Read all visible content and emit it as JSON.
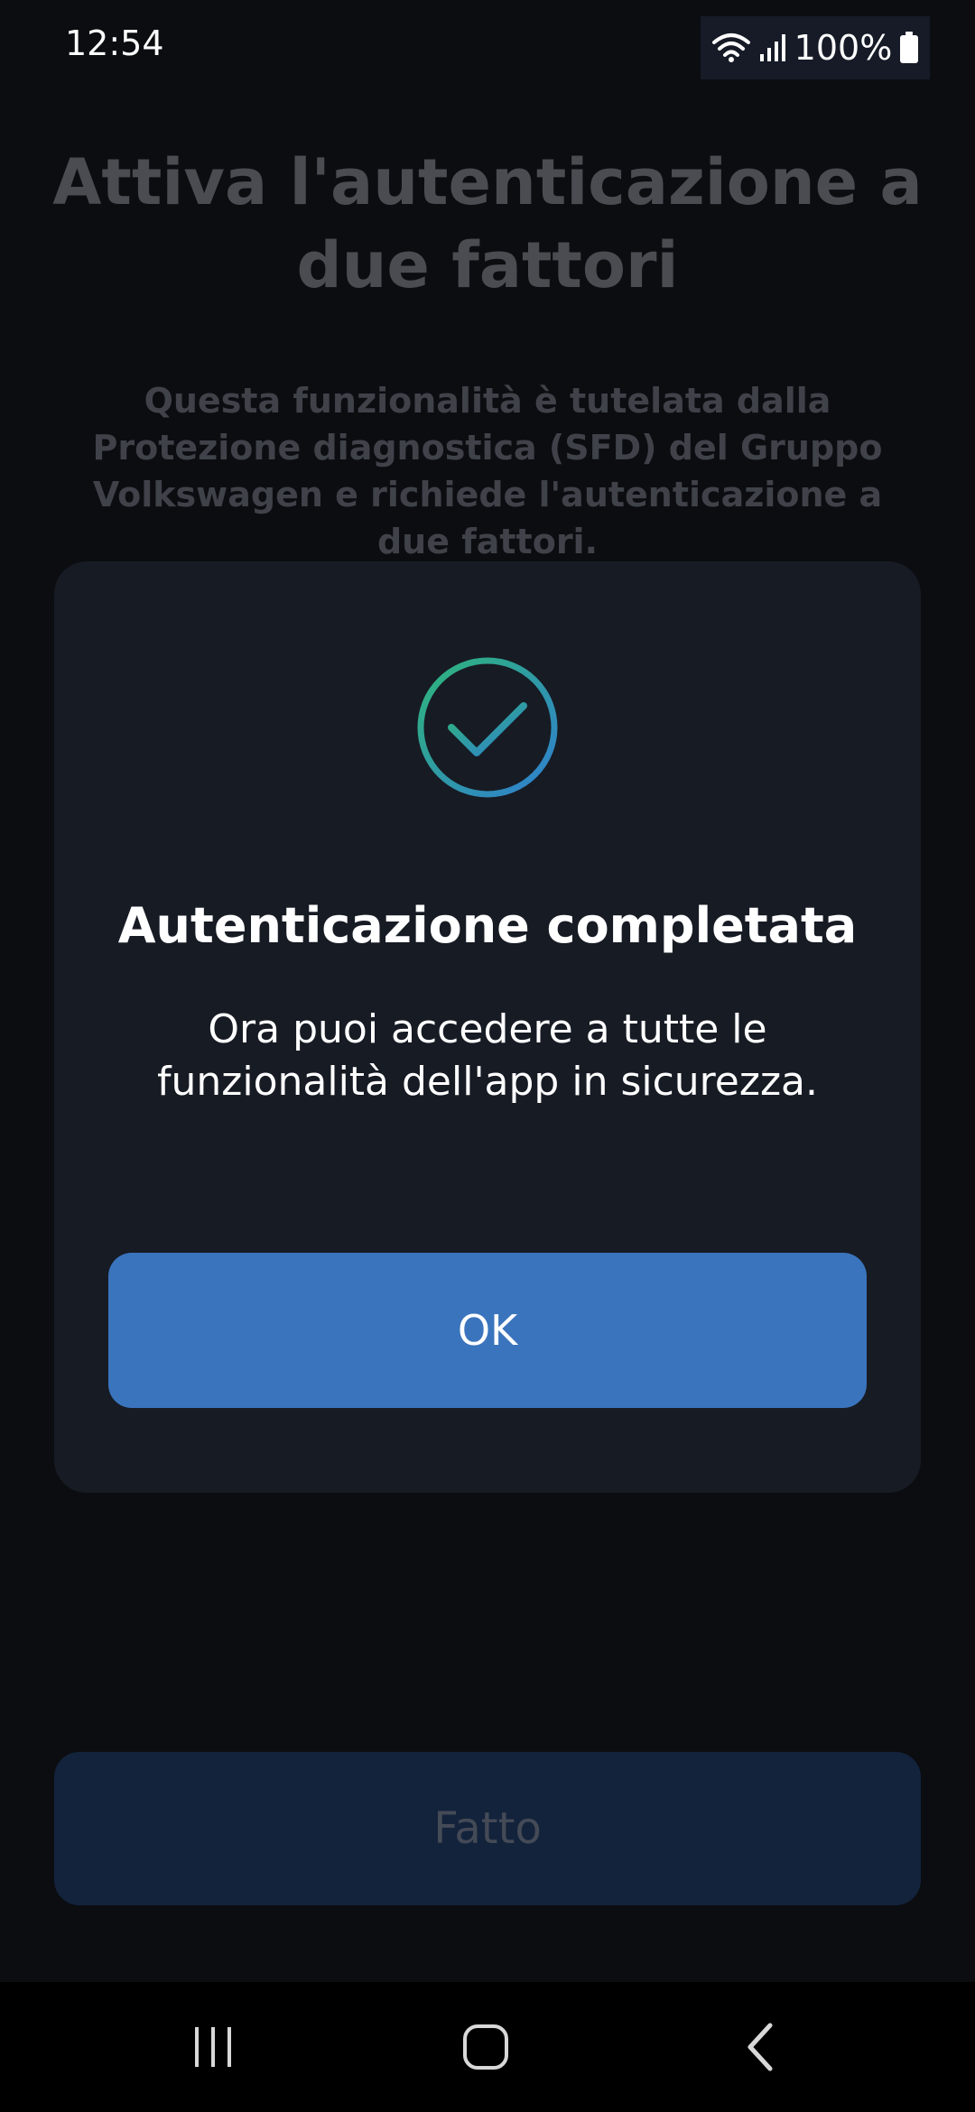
{
  "status_bar": {
    "time": "12:54",
    "battery": "100%",
    "icons": [
      "wifi-icon",
      "signal-icon",
      "battery-icon"
    ]
  },
  "page": {
    "title": "Attiva l'autenticazione a due fattori",
    "description": "Questa funzionalità è tutelata dalla Protezione diagnostica (SFD) del Gruppo Volkswagen e richiede l'autenticazione a due fattori.",
    "done_label": "Fatto"
  },
  "dialog": {
    "icon": "checkmark-circle-icon",
    "title": "Autenticazione completata",
    "message": "Ora puoi accedere a tutte le funzionalità dell'app in sicurezza.",
    "ok_label": "OK"
  },
  "nav_bar": {
    "icons": [
      "recent-apps-icon",
      "home-icon",
      "back-icon"
    ]
  },
  "colors": {
    "accent": "#3a74bd",
    "dialog_bg": "#171b24",
    "background": "#0b0d11",
    "check_gradient_start": "#2fb57a",
    "check_gradient_end": "#2f7fd0"
  }
}
